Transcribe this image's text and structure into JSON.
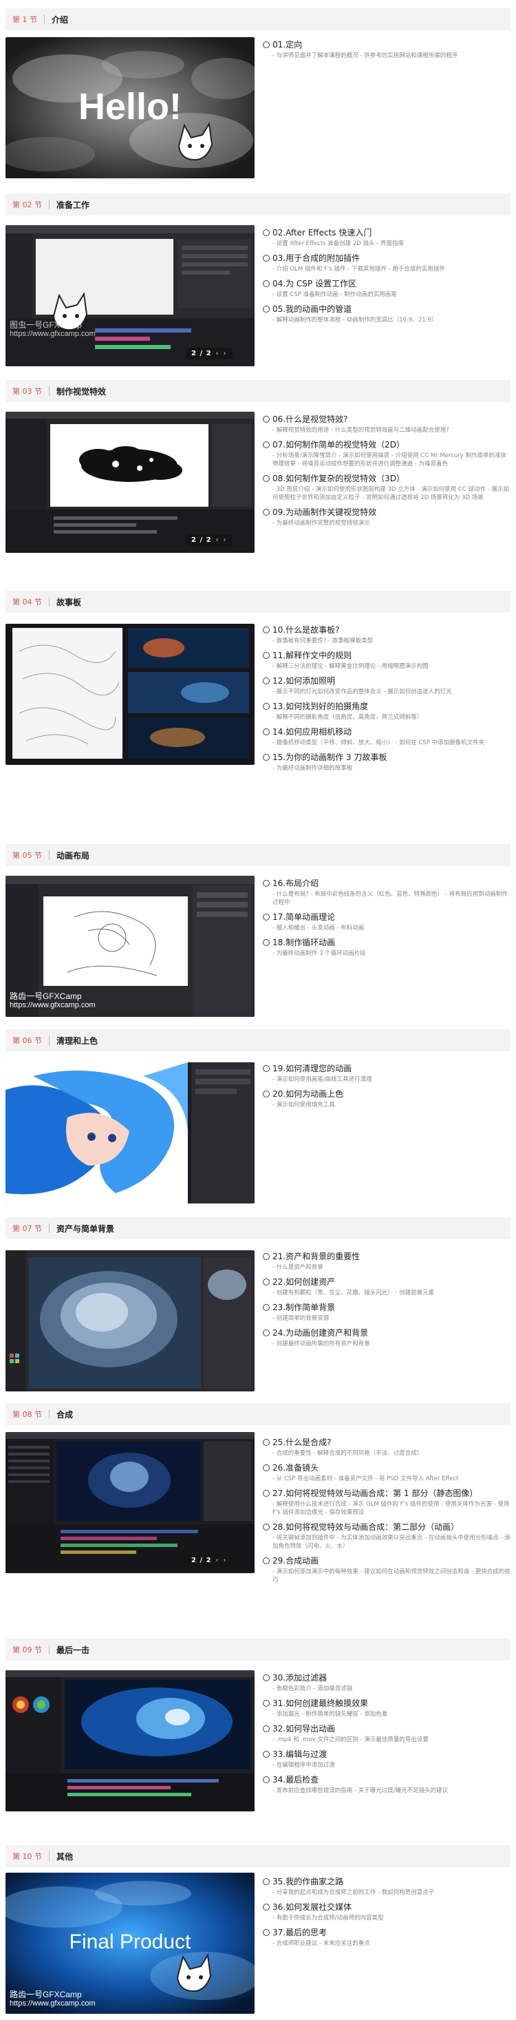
{
  "sections": [
    {
      "num": "第 1 节",
      "title": "介绍",
      "overlay_text": "Hello!",
      "lessons": [
        {
          "title": "01.定向",
          "desc": "- 与讲师见面并了解本课程的概况 - 供参考的实用网站和课程所需的程序"
        }
      ]
    },
    {
      "num": "第 02 节",
      "title": "准备工作",
      "watermark": [
        "图虫一号GFXCamp",
        "https://www.gfxcamp.com"
      ],
      "pager": "2 / 2",
      "lessons": [
        {
          "title": "02.After Effects 快速入门",
          "desc": "- 设置 After Effects 准备创建 2D 插头 - 界面指南"
        },
        {
          "title": "03.用于合成的附加插件",
          "desc": "- 介绍 OLM 插件和 F's 插件 - 下载其他插件 - 用于合成的实用插件"
        },
        {
          "title": "04.为 CSP 设置工作区",
          "desc": "- 设置 CSP 准备制作动画 - 制作动画的实用画笔"
        },
        {
          "title": "05.我的动画中的管道",
          "desc": "- 解释动画制作的整体流程 - 动画制作的宽高比（16:9、21:9）"
        }
      ]
    },
    {
      "num": "第 03 节",
      "title": "制作视觉特效",
      "pager": "2 / 2",
      "lessons": [
        {
          "title": "06.什么是视觉特效?",
          "desc": "- 解释视觉特效的用途 - 什么类型的视觉特效能与二维动画配合使用?"
        },
        {
          "title": "07.如何制作简单的视觉特效（2D）",
          "desc": "- 分析场景/演示降雪简介 - 演示如何使用噪音 - 介绍使用 CC Mr Mercury 制作简单的液体物理效果 - 将噪音运动成作想要的形状并进行调整通道 - 为噪音着色"
        },
        {
          "title": "08.如何制作复杂的视觉特效（3D）",
          "desc": "- 3D 图层介绍 - 演示如何使用形状图层构建 3D 立方体 - 演示如何使用 CC 球动作 - 展示如何使用粒子世界和添加自定义粒子 - 说明如何通过透视将 2D 场景转化为 3D 场景"
        },
        {
          "title": "09.为动画制作关键视觉特效",
          "desc": "- 为最终动画制作完整的视觉特效演示"
        }
      ]
    },
    {
      "num": "第 04 节",
      "title": "故事板",
      "lessons": [
        {
          "title": "10.什么是故事板?",
          "desc": "- 故事板有何重要性? - 故事板模板类型"
        },
        {
          "title": "11.解释作文中的规则",
          "desc": "- 解释三分法的理论 - 解释黄金比例理论 - 用缩略图演示构图"
        },
        {
          "title": "12.如何添加照明",
          "desc": "- 展示不同的灯光如何改变作品的整体含义 - 展示如何创造迷人的灯光"
        },
        {
          "title": "13.如何找到好的拍摄角度",
          "desc": "- 解释不同的摄影角度（低角度、高角度、荷兰式倾斜等）"
        },
        {
          "title": "14.如何应用相机移动",
          "desc": "- 摄像机移动类型（平移、倾斜、放大、缩小） - 如何在 CSP 中添加摄像机文件夹"
        },
        {
          "title": "15.为你的动画制作 3 刀故事板",
          "desc": "- 为最终动画制作详细的故事板"
        }
      ]
    },
    {
      "num": "第 05 节",
      "title": "动画布局",
      "watermark": [
        "路齿一号GFXCamp",
        "https://www.gfxcamp.com"
      ],
      "lessons": [
        {
          "title": "16.布局介绍",
          "desc": "- 什么是布局? - 布局中彩色线条的含义（红色、蓝色、特殊颜色） - 将布局应用到动画制作过程中"
        },
        {
          "title": "17.简单动画理论",
          "desc": "- 缓入和缓出 - 头发动画 - 布料动画"
        },
        {
          "title": "18.制作循环动画",
          "desc": "- 为最终动画制作 3 个循环动画片段"
        }
      ]
    },
    {
      "num": "第 06 节",
      "title": "清理和上色",
      "lessons": [
        {
          "title": "19.如何清理您的动画",
          "desc": "- 演示如何使用画笔/曲线工具进行清理"
        },
        {
          "title": "20.如何为动画上色",
          "desc": "- 演示如何使用填充工具"
        }
      ]
    },
    {
      "num": "第 07 节",
      "title": "资产与简单背景",
      "lessons": [
        {
          "title": "21.资产和背景的重要性",
          "desc": "- 什么是资产和背景"
        },
        {
          "title": "22.如何创建资产",
          "desc": "- 创建有机颗粒（雪、灰尘、花瓣、镜头闪光） - 创建前景元素"
        },
        {
          "title": "23.制作简单背景",
          "desc": "- 创建简单的背景资源"
        },
        {
          "title": "24.为动画创建资产和背景",
          "desc": "- 创建最终动画所需的所有资产和背景"
        }
      ]
    },
    {
      "num": "第 08 节",
      "title": "合成",
      "pager": "2 / 2",
      "lessons": [
        {
          "title": "25.什么是合成?",
          "desc": "- 合成的重要性 - 解释合成的不同风格（平淡、过度合成）"
        },
        {
          "title": "26.准备镜头",
          "desc": "- 从 CSP 导出动画素材 - 准备资产文件 - 将 PSD 文件导入 After Effect"
        },
        {
          "title": "27.如何将视觉特效与动画合成：第 1 部分（静态图像）",
          "desc": "- 解释使用什么技术进行合成 - 演示 OLM 插件和 F's 插件的使用 - 使用关体作为光源 - 使用 F's 插件添加边缘光 - 保存效果预设"
        },
        {
          "title": "28.如何将视觉特效与动画合成：第二部分（动画）",
          "desc": "- 将关键帧添加到插件中 - 为实体添加动画效果以突出重点 - 在动画镜头中使用分形噪点 - 添加角色特效（闪电、火、水）"
        },
        {
          "title": "29.合成动画",
          "desc": "- 演示如何添加演示中的每种效果 - 建议如何在动画和视觉特效之间创造和谐 - 更快合成的技巧"
        }
      ]
    },
    {
      "num": "第 09 节",
      "title": "最后一击",
      "lessons": [
        {
          "title": "30.添加过滤器",
          "desc": "- 鱼眼色彩简介 - 添加噪音滤镜"
        },
        {
          "title": "31.如何创建最终触摸效果",
          "desc": "- 添加漏光 - 制作简单的镜头耀斑 - 添加色差"
        },
        {
          "title": "32.如何导出动画",
          "desc": "- .mp4 和 .mov 文件之间的区别 - 演示最佳质量的导出设置"
        },
        {
          "title": "33.编辑与过渡",
          "desc": "- 在编辑程序中添加过渡"
        },
        {
          "title": "34.最后检查",
          "desc": "- 发布前应查找哪些错误的指南 - 关于曝光过度/曝光不足镜头的建议"
        }
      ]
    },
    {
      "num": "第 10 节",
      "title": "其他",
      "overlay_text": "Final Product",
      "watermark": [
        "路齿一号GFXCamp",
        "https://www.gfxcamp.com"
      ],
      "lessons": [
        {
          "title": "35.我的作曲家之路",
          "desc": "- 分享我的起点和成为合成师之前的工作 - 我如何构思创意点子"
        },
        {
          "title": "36.如何发展社交媒体",
          "desc": "- 有助于你成长为合成师/动画师的内容类型"
        },
        {
          "title": "37.最后的思考",
          "desc": "- 合成师职业建议 - 未来应关注的重点"
        }
      ]
    }
  ]
}
